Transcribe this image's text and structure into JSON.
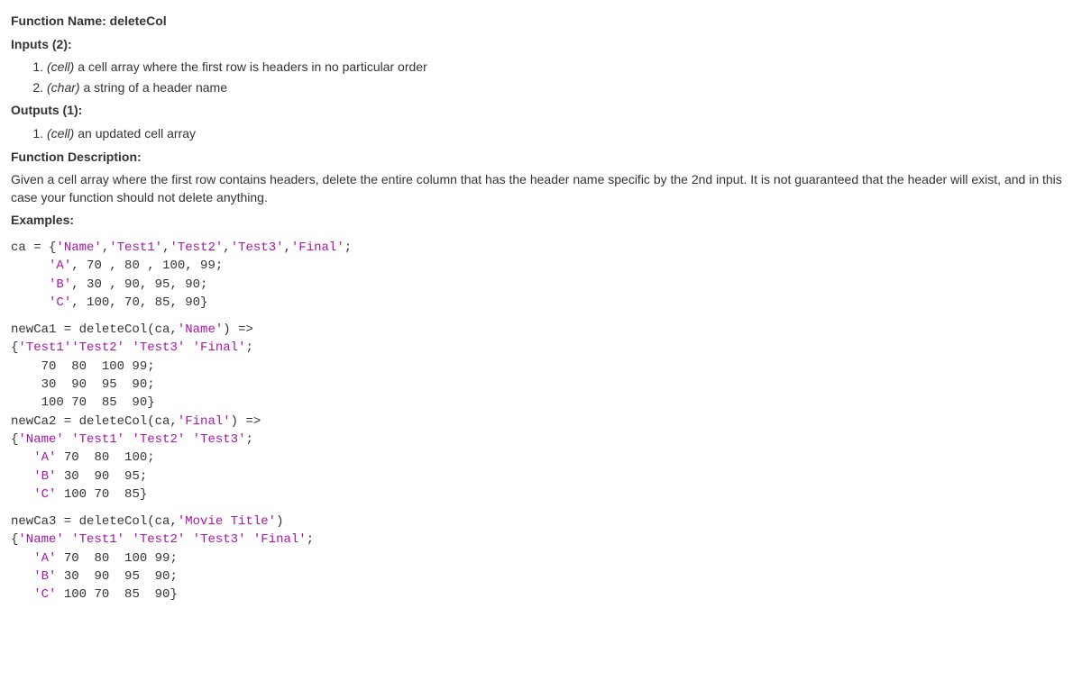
{
  "text": {
    "fn_label": "Function Name: ",
    "fn_name": "deleteCol",
    "inputs_label": "Inputs (2):",
    "input1_type": "(cell)",
    "input1_desc": " a cell array where the first row is headers in no particular order",
    "input2_type": "(char)",
    "input2_desc": " a string of a header name",
    "outputs_label": "Outputs (1):",
    "output1_type": "(cell)",
    "output1_desc": " an updated cell array",
    "fndesc_label": "Function Description:",
    "fndesc_body": "Given a cell array where the first row contains headers, delete the entire column that has the header name specific by the 2nd input. It is not guaranteed that the header will exist, and in this case your function should not delete anything.",
    "examples_label": "Examples:"
  },
  "code1": {
    "l1a": "ca = {",
    "l1b": "'Name'",
    "l1c": ",",
    "l1d": "'Test1'",
    "l1e": ",",
    "l1f": "'Test2'",
    "l1g": ",",
    "l1h": "'Test3'",
    "l1i": ",",
    "l1j": "'Final'",
    "l1k": ";",
    "l2a": "     ",
    "l2b": "'A'",
    "l2c": ", 70 , 80 , 100, 99;",
    "l3a": "     ",
    "l3b": "'B'",
    "l3c": ", 30 , 90, 95, 90;",
    "l4a": "     ",
    "l4b": "'C'",
    "l4c": ", 100, 70, 85, 90}"
  },
  "code2": {
    "l1a": "newCa1 = deleteCol(ca,",
    "l1b": "'Name'",
    "l1c": ") =>",
    "l2a": "{",
    "l2b": "'Test1'",
    "l2c": "'Test2'",
    "l2d": " ",
    "l2e": "'Test3'",
    "l2f": " ",
    "l2g": "'Final'",
    "l2h": ";",
    "l3": "    70  80  100 99;",
    "l4": "    30  90  95  90;",
    "l5": "    100 70  85  90}",
    "l6a": "newCa2 = deleteCol(ca,",
    "l6b": "'Final'",
    "l6c": ") =>",
    "l7a": "{",
    "l7b": "'Name'",
    "l7c": " ",
    "l7d": "'Test1'",
    "l7e": " ",
    "l7f": "'Test2'",
    "l7g": " ",
    "l7h": "'Test3'",
    "l7i": ";",
    "l8a": "   ",
    "l8b": "'A'",
    "l8c": " 70  80  100;",
    "l9a": "   ",
    "l9b": "'B'",
    "l9c": " 30  90  95;",
    "l10a": "   ",
    "l10b": "'C'",
    "l10c": " 100 70  85}"
  },
  "code3": {
    "l1a": "newCa3 = deleteCol(ca,",
    "l1b": "'Movie Title'",
    "l1c": ")",
    "l2a": "{",
    "l2b": "'Name'",
    "l2c": " ",
    "l2d": "'Test1'",
    "l2e": " ",
    "l2f": "'Test2'",
    "l2g": " ",
    "l2h": "'Test3'",
    "l2i": " ",
    "l2j": "'Final'",
    "l2k": ";",
    "l3a": "   ",
    "l3b": "'A'",
    "l3c": " 70  80  100 99;",
    "l4a": "   ",
    "l4b": "'B'",
    "l4c": " 30  90  95  90;",
    "l5a": "   ",
    "l5b": "'C'",
    "l5c": " 100 70  85  90}"
  }
}
